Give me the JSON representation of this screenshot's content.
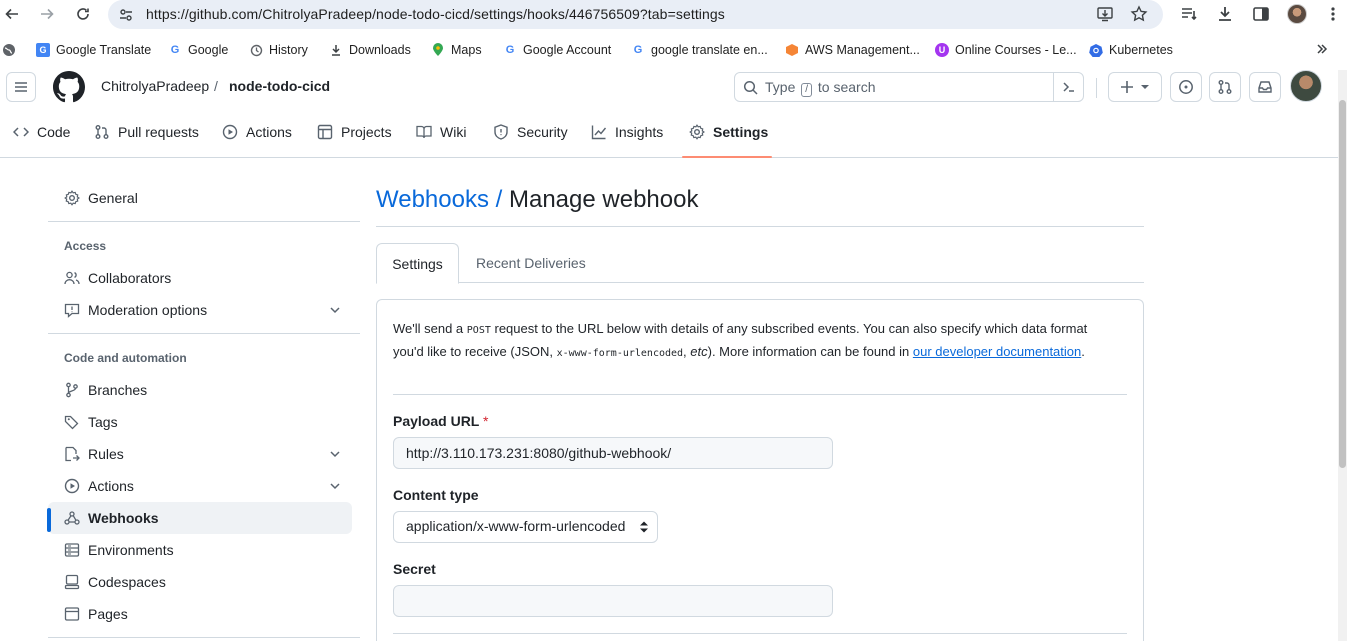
{
  "browser": {
    "url": "https://github.com/ChitrolyaPradeep/node-todo-cicd/settings/hooks/446756509?tab=settings",
    "bookmarks": [
      {
        "label": "Google Translate",
        "icon": "google-translate-icon",
        "color": "#4285f4"
      },
      {
        "label": "Google",
        "icon": "google-icon",
        "color": "#4285f4"
      },
      {
        "label": "History",
        "icon": "history-icon",
        "color": "#5f6368"
      },
      {
        "label": "Downloads",
        "icon": "download-icon",
        "color": "#5f6368"
      },
      {
        "label": "Maps",
        "icon": "maps-pin-icon",
        "color": "#34a853"
      },
      {
        "label": "Google Account",
        "icon": "google-icon",
        "color": "#4285f4"
      },
      {
        "label": "google translate en...",
        "icon": "google-icon",
        "color": "#4285f4"
      },
      {
        "label": "AWS Management...",
        "icon": "aws-cube-icon",
        "color": "#f58536"
      },
      {
        "label": "Online Courses - Le...",
        "icon": "udemy-icon",
        "color": "#a435f0"
      },
      {
        "label": "Kubernetes",
        "icon": "kubernetes-icon",
        "color": "#326ce5"
      }
    ]
  },
  "header": {
    "owner": "ChitrolyaPradeep",
    "separator": "/",
    "repo": "node-todo-cicd",
    "search_prefix": "Type",
    "search_key": "/",
    "search_suffix": "to search"
  },
  "repo_tabs": [
    {
      "label": "Code",
      "icon": "code-icon"
    },
    {
      "label": "Pull requests",
      "icon": "pull-request-icon"
    },
    {
      "label": "Actions",
      "icon": "play-icon"
    },
    {
      "label": "Projects",
      "icon": "table-icon"
    },
    {
      "label": "Wiki",
      "icon": "book-icon"
    },
    {
      "label": "Security",
      "icon": "shield-icon"
    },
    {
      "label": "Insights",
      "icon": "graph-icon"
    },
    {
      "label": "Settings",
      "icon": "gear-icon",
      "active": true
    }
  ],
  "sidebar": {
    "general": "General",
    "access_heading": "Access",
    "access_items": [
      {
        "label": "Collaborators",
        "icon": "people-icon"
      },
      {
        "label": "Moderation options",
        "icon": "report-icon",
        "expandable": true
      }
    ],
    "code_heading": "Code and automation",
    "code_items": [
      {
        "label": "Branches",
        "icon": "branch-icon"
      },
      {
        "label": "Tags",
        "icon": "tag-icon"
      },
      {
        "label": "Rules",
        "icon": "rules-icon",
        "expandable": true
      },
      {
        "label": "Actions",
        "icon": "play-icon",
        "expandable": true
      },
      {
        "label": "Webhooks",
        "icon": "webhook-icon",
        "active": true
      },
      {
        "label": "Environments",
        "icon": "server-icon"
      },
      {
        "label": "Codespaces",
        "icon": "codespaces-icon"
      },
      {
        "label": "Pages",
        "icon": "browser-icon"
      }
    ]
  },
  "main": {
    "breadcrumb_link": "Webhooks",
    "breadcrumb_sep": " / ",
    "title": "Manage webhook",
    "subtabs": [
      "Settings",
      "Recent Deliveries"
    ],
    "intro_1": "We'll send a ",
    "intro_code_1": "POST",
    "intro_2": " request to the URL below with details of any subscribed events. You can also specify which data format you'd like to receive (JSON, ",
    "intro_code_2": "x-www-form-urlencoded",
    "intro_3": ", ",
    "intro_etc": "etc",
    "intro_4": "). More information can be found in ",
    "intro_link": "our developer documentation",
    "intro_5": ".",
    "payload_label": "Payload URL",
    "required_mark": "*",
    "payload_value": "http://3.110.173.231:8080/github-webhook/",
    "content_type_label": "Content type",
    "content_type_value": "application/x-www-form-urlencoded",
    "secret_label": "Secret",
    "secret_value": ""
  },
  "colors": {
    "accent_blue": "#0969da",
    "active_tab_underline": "#fd8c73",
    "border": "#d1d9e0"
  }
}
